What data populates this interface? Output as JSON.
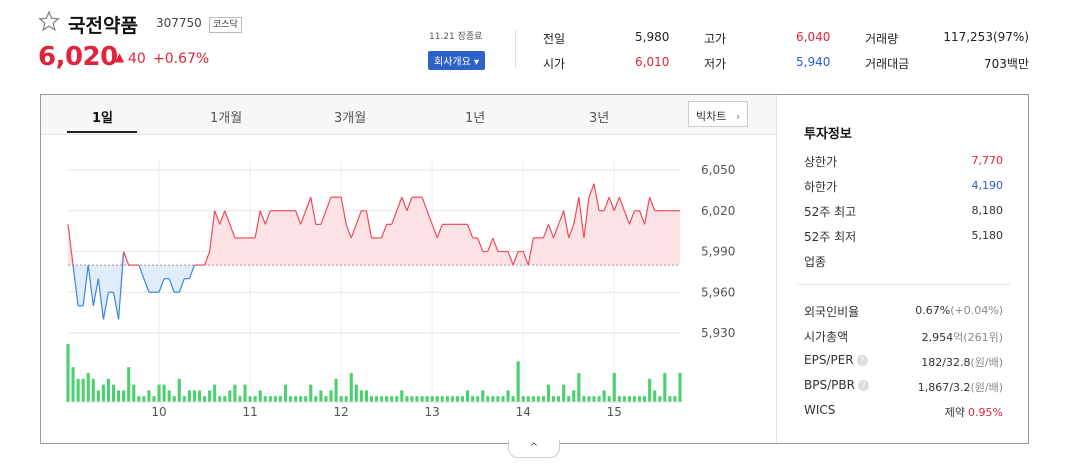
{
  "stock": {
    "name": "국전약품",
    "code": "307750",
    "market_badge": "코스닥",
    "price": "6,020",
    "change_arrow": "▲",
    "change": "40",
    "change_pct": "+0.67%",
    "time": "11.21 장종료",
    "company_button": "회사개요 ▾"
  },
  "summary": [
    {
      "label": "전일",
      "value": "5,980",
      "color": "#222222"
    },
    {
      "label": "고가",
      "value": "6,040",
      "color": "#e0243c"
    },
    {
      "label": "거래량",
      "value": "117,253(97%)",
      "color": "#222222"
    },
    {
      "label": "시가",
      "value": "6,010",
      "color": "#e0243c"
    },
    {
      "label": "저가",
      "value": "5,940",
      "color": "#2a5bd7"
    },
    {
      "label": "거래대금",
      "value": "703백만",
      "color": "#222222"
    }
  ],
  "tabs": [
    "1일",
    "1개월",
    "3개월",
    "1년",
    "3년"
  ],
  "active_tab": "1일",
  "bigchart_label": "빅차트",
  "chart_data": {
    "type": "line",
    "baseline": 5980,
    "ylim": [
      5930,
      6050
    ],
    "y_ticks": [
      "6,050",
      "6,020",
      "5,990",
      "5,960",
      "5,930"
    ],
    "y_tick_values": [
      6050,
      6020,
      5990,
      5960,
      5930
    ],
    "x_ticks": [
      "10",
      "11",
      "12",
      "13",
      "14",
      "15"
    ],
    "x_tick_index": [
      18,
      36,
      54,
      72,
      90,
      108
    ],
    "x_start_hour": 9,
    "x_end_hour": 15.5,
    "prices": [
      6010,
      5980,
      5950,
      5950,
      5980,
      5950,
      5970,
      5940,
      5960,
      5960,
      5940,
      5990,
      5980,
      5980,
      5980,
      5970,
      5960,
      5960,
      5960,
      5970,
      5970,
      5960,
      5960,
      5970,
      5970,
      5980,
      5980,
      5980,
      5990,
      6020,
      6010,
      6020,
      6010,
      6000,
      6000,
      6000,
      6000,
      6000,
      6020,
      6010,
      6020,
      6020,
      6020,
      6020,
      6020,
      6020,
      6010,
      6020,
      6030,
      6010,
      6010,
      6020,
      6030,
      6030,
      6030,
      6010,
      6000,
      6010,
      6020,
      6020,
      6000,
      6000,
      6000,
      6010,
      6010,
      6020,
      6030,
      6020,
      6030,
      6030,
      6030,
      6020,
      6010,
      6000,
      6010,
      6010,
      6010,
      6010,
      6010,
      6010,
      6000,
      6000,
      5990,
      5990,
      6000,
      5990,
      5990,
      5990,
      5980,
      5990,
      5990,
      5980,
      6000,
      6000,
      6000,
      6010,
      6000,
      6010,
      6020,
      6000,
      6010,
      6030,
      6000,
      6030,
      6040,
      6020,
      6020,
      6030,
      6020,
      6030,
      6020,
      6010,
      6020,
      6020,
      6010,
      6030,
      6020,
      6020,
      6020,
      6020,
      6020,
      6020
    ],
    "volumes": [
      10,
      6,
      4,
      4,
      5,
      4,
      2,
      3,
      4,
      3,
      2,
      2,
      6,
      3,
      1,
      1,
      2,
      1,
      3,
      3,
      2,
      1,
      4,
      1,
      2,
      2,
      2,
      1,
      2,
      3,
      1,
      1,
      2,
      3,
      1,
      3,
      1,
      1,
      2,
      1,
      1,
      1,
      1,
      3,
      1,
      1,
      1,
      1,
      3,
      1,
      2,
      1,
      2,
      4,
      1,
      1,
      5,
      3,
      2,
      2,
      1,
      1,
      1,
      1,
      1,
      1,
      2,
      1,
      1,
      1,
      1,
      1,
      1,
      1,
      1,
      1,
      1,
      1,
      1,
      2,
      1,
      1,
      2,
      1,
      1,
      1,
      1,
      2,
      1,
      7,
      1,
      1,
      1,
      1,
      1,
      3,
      1,
      1,
      3,
      1,
      2,
      5,
      1,
      1,
      1,
      1,
      2,
      1,
      5,
      1,
      1,
      1,
      1,
      1,
      1,
      4,
      2,
      1,
      5,
      1,
      1,
      5
    ]
  },
  "invest": {
    "title": "투자정보",
    "rows": [
      {
        "label": "상한가",
        "value": "7,770",
        "color": "#e0243c"
      },
      {
        "label": "하한가",
        "value": "4,190",
        "color": "#2a5bd7"
      },
      {
        "label": "52주 최고",
        "value": "8,180",
        "color": "#333333"
      },
      {
        "label": "52주 최저",
        "value": "5,180",
        "color": "#333333"
      },
      {
        "label": "업종",
        "value": "",
        "color": "#333333"
      }
    ],
    "rows2": [
      {
        "label": "외국인비율",
        "value": "0.67%",
        "extra": "(+0.04%)",
        "help": false
      },
      {
        "label": "시가총액",
        "value": "2,954",
        "extra": "억(261위)",
        "help": false
      },
      {
        "label": "EPS/PER",
        "value": "182/32.8",
        "extra": "(원/배)",
        "help": true
      },
      {
        "label": "BPS/PBR",
        "value": "1,867/3.2",
        "extra": "(원/배)",
        "help": true
      },
      {
        "label": "WICS",
        "value": "제약",
        "extra": "0.95%",
        "help": false
      }
    ],
    "help_icon_text": "?"
  },
  "collapse_icon": "^"
}
